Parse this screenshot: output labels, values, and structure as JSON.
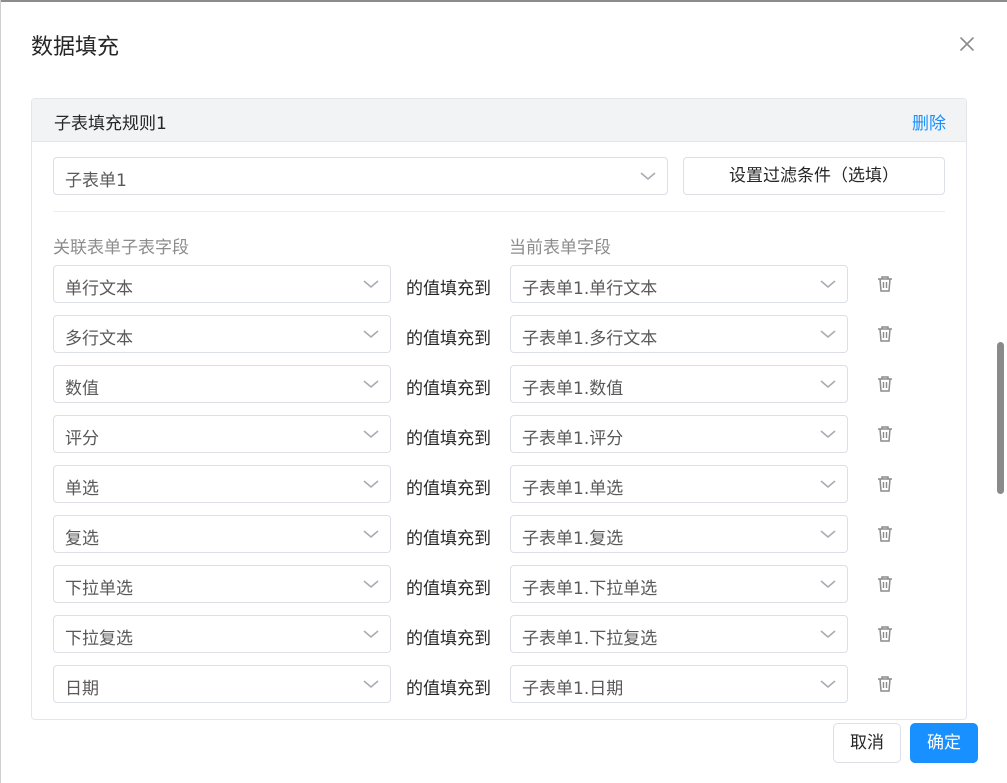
{
  "dialog": {
    "title": "数据填充",
    "close_icon": "close-icon"
  },
  "rule": {
    "title": "子表填充规则1",
    "delete_label": "删除",
    "subtable_select": "子表单1",
    "filter_button": "设置过滤条件（选填）",
    "left_column_label": "关联表单子表字段",
    "right_column_label": "当前表单字段",
    "mappings": [
      {
        "source": "单行文本",
        "connector": "的值填充到",
        "target": "子表单1.单行文本"
      },
      {
        "source": "多行文本",
        "connector": "的值填充到",
        "target": "子表单1.多行文本"
      },
      {
        "source": "数值",
        "connector": "的值填充到",
        "target": "子表单1.数值"
      },
      {
        "source": "评分",
        "connector": "的值填充到",
        "target": "子表单1.评分"
      },
      {
        "source": "单选",
        "connector": "的值填充到",
        "target": "子表单1.单选"
      },
      {
        "source": "复选",
        "connector": "的值填充到",
        "target": "子表单1.复选"
      },
      {
        "source": "下拉单选",
        "connector": "的值填充到",
        "target": "子表单1.下拉单选"
      },
      {
        "source": "下拉复选",
        "connector": "的值填充到",
        "target": "子表单1.下拉复选"
      },
      {
        "source": "日期",
        "connector": "的值填充到",
        "target": "子表单1.日期"
      }
    ]
  },
  "footer": {
    "cancel_label": "取消",
    "confirm_label": "确定"
  },
  "colors": {
    "accent": "#1890ff",
    "header_bg": "#f2f3f5",
    "border": "#dcdfe6"
  }
}
